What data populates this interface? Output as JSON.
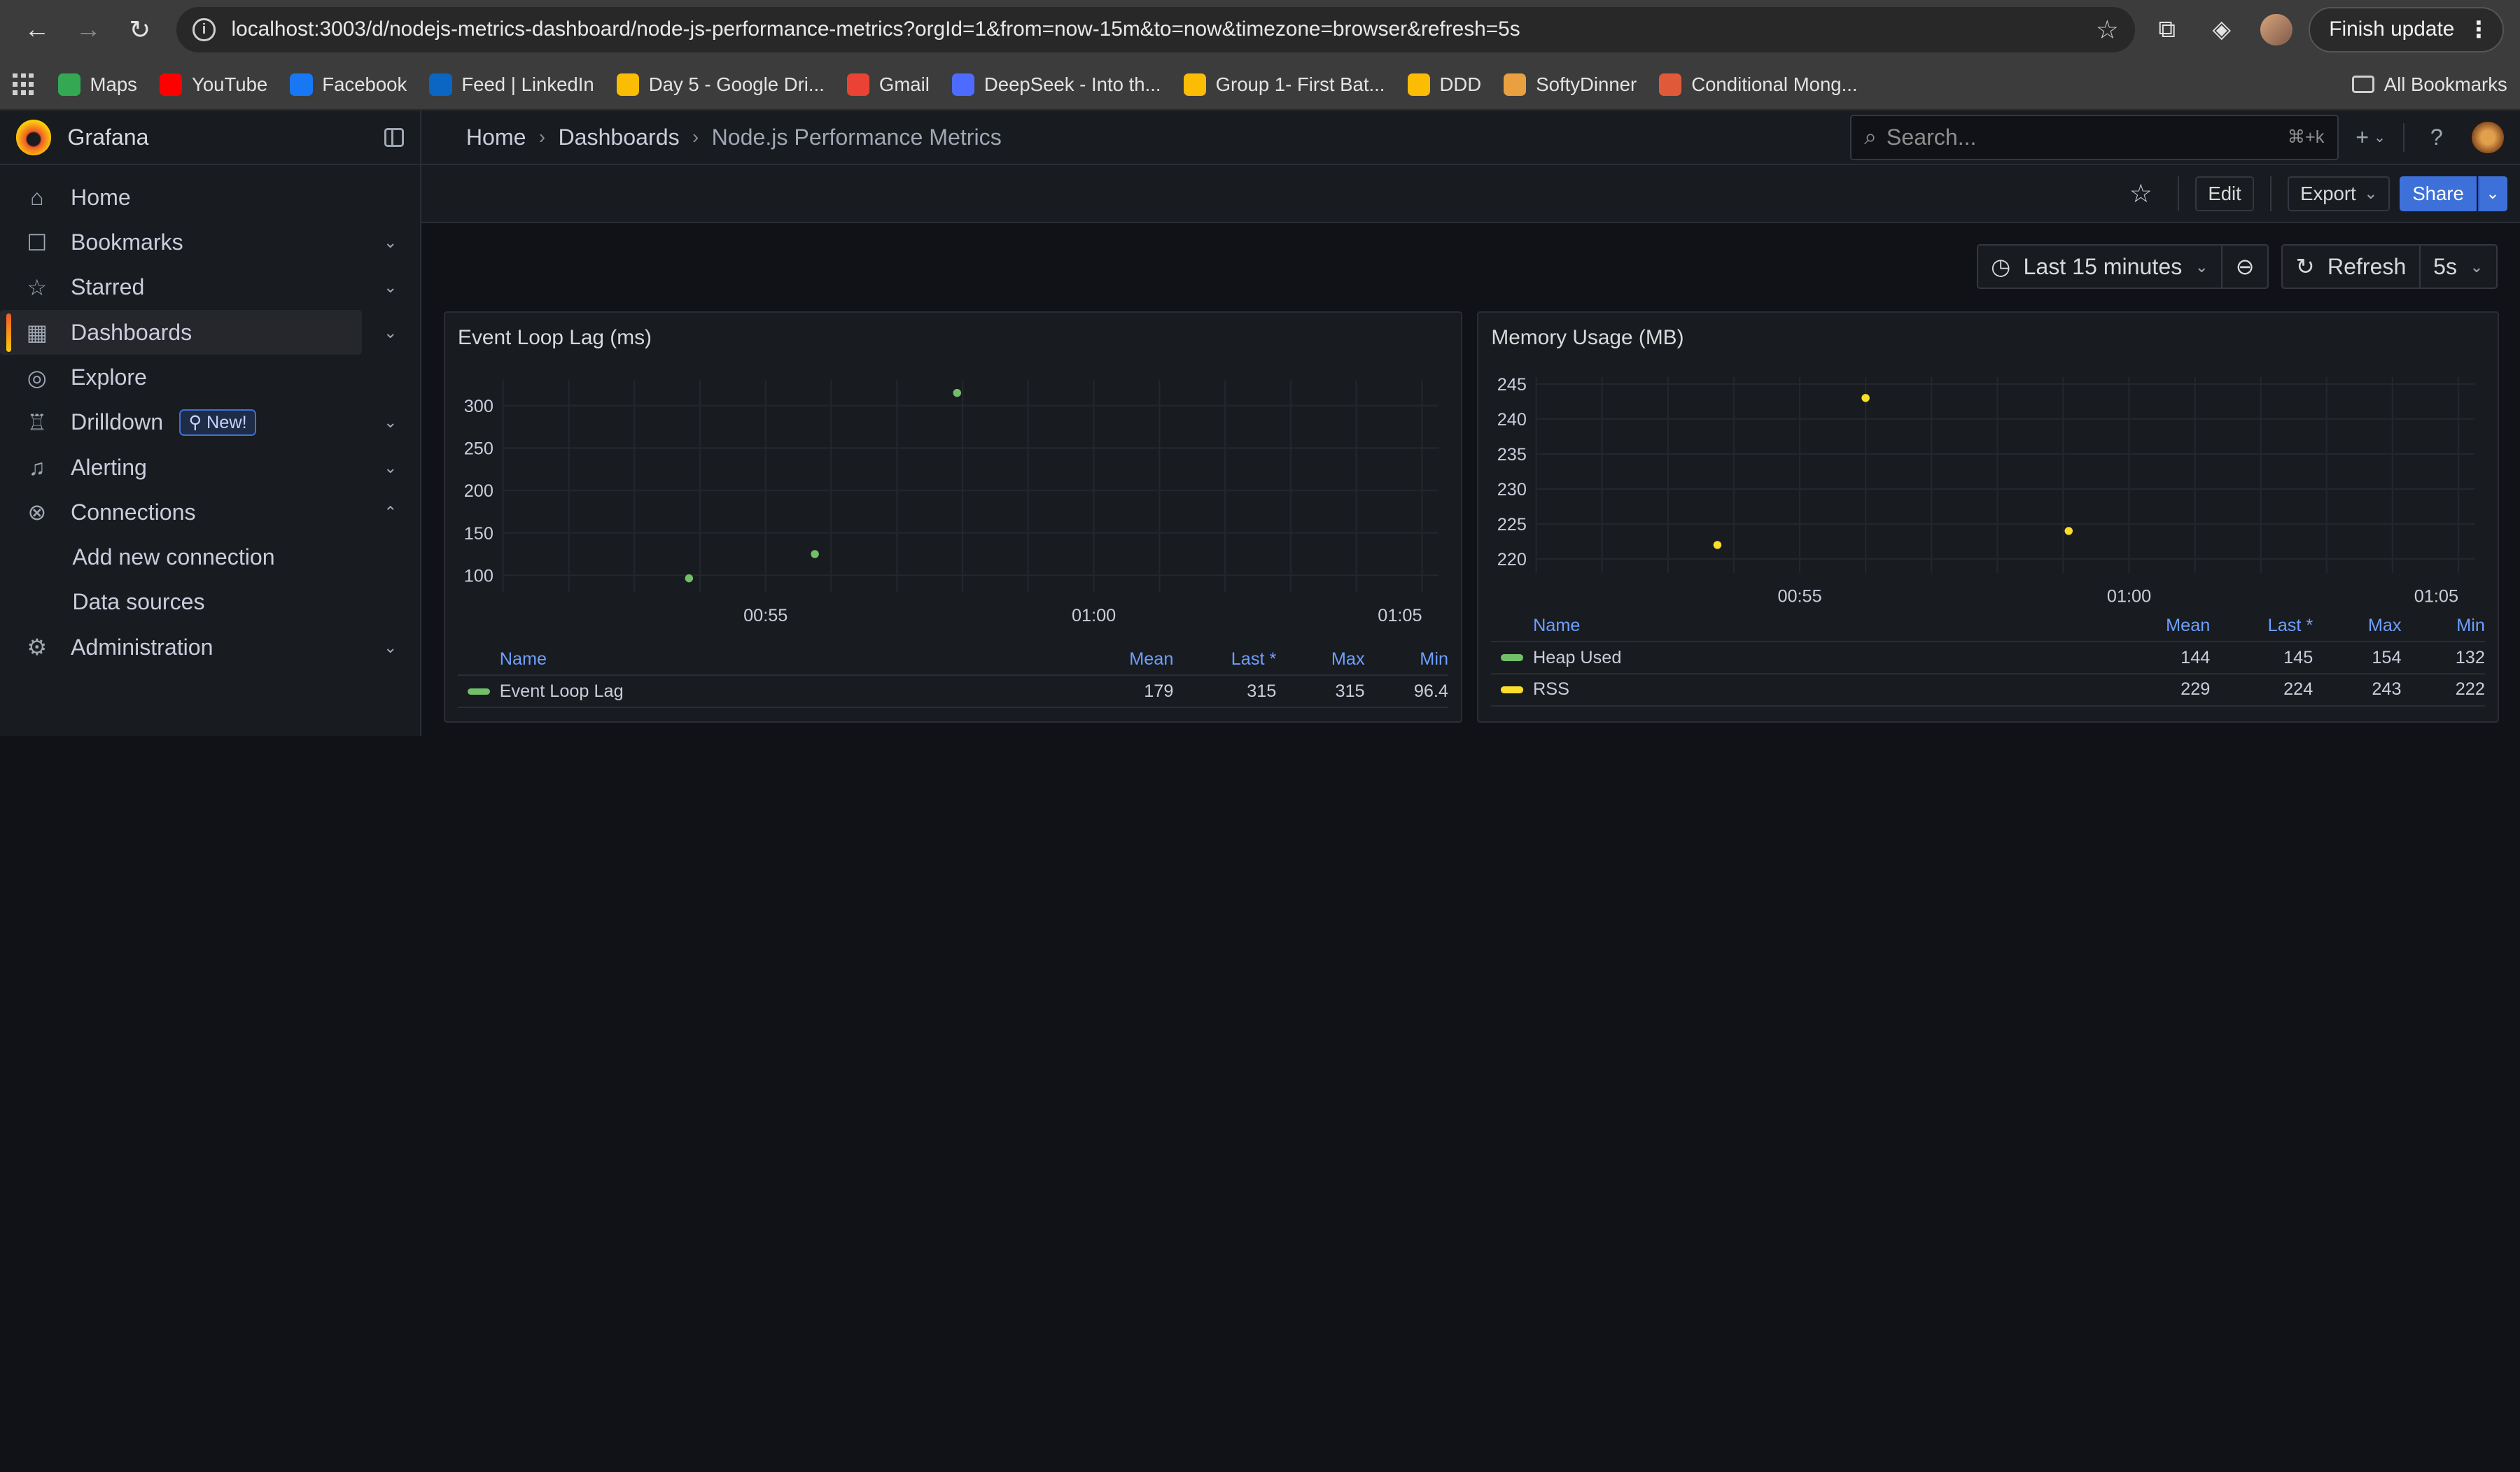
{
  "browser": {
    "url": "localhost:3003/d/nodejs-metrics-dashboard/node-js-performance-metrics?orgId=1&from=now-15m&to=now&timezone=browser&refresh=5s",
    "finish_update": "Finish update",
    "bookmarks": [
      {
        "label": "Maps",
        "color": "#34a853"
      },
      {
        "label": "YouTube",
        "color": "#ff0000"
      },
      {
        "label": "Facebook",
        "color": "#1877f2"
      },
      {
        "label": "Feed | LinkedIn",
        "color": "#0a66c2"
      },
      {
        "label": "Day 5 - Google Dri...",
        "color": "#fbbc04"
      },
      {
        "label": "Gmail",
        "color": "#ea4335"
      },
      {
        "label": "DeepSeek - Into th...",
        "color": "#4d6bfe"
      },
      {
        "label": "Group 1- First Bat...",
        "color": "#fbbc04"
      },
      {
        "label": "DDD",
        "color": "#fbbc04"
      },
      {
        "label": "SoftyDinner",
        "color": "#e8a040"
      },
      {
        "label": "Conditional Mong...",
        "color": "#e05a3a"
      }
    ],
    "all_bookmarks": "All Bookmarks"
  },
  "sidebar": {
    "title": "Grafana",
    "items": [
      {
        "label": "Home",
        "icon": "home-icon",
        "glyph": "⌂",
        "chevron": ""
      },
      {
        "label": "Bookmarks",
        "icon": "bookmark-icon",
        "glyph": "☐",
        "chevron": "⌄"
      },
      {
        "label": "Starred",
        "icon": "star-icon",
        "glyph": "☆",
        "chevron": "⌄"
      },
      {
        "label": "Dashboards",
        "icon": "dashboards-icon",
        "glyph": "▦",
        "chevron": "⌄"
      },
      {
        "label": "Explore",
        "icon": "compass-icon",
        "glyph": "◎",
        "chevron": ""
      },
      {
        "label": "Drilldown",
        "icon": "drilldown-icon",
        "glyph": "♖",
        "chevron": "⌄",
        "badge": "New!"
      },
      {
        "label": "Alerting",
        "icon": "bell-icon",
        "glyph": "♫",
        "chevron": "⌄"
      },
      {
        "label": "Connections",
        "icon": "connections-icon",
        "glyph": "⊗",
        "chevron": "⌃"
      }
    ],
    "sub_items": [
      "Add new connection",
      "Data sources"
    ],
    "admin": {
      "label": "Administration",
      "icon": "gear-icon",
      "glyph": "⚙",
      "chevron": "⌄"
    }
  },
  "topbar": {
    "breadcrumb": [
      "Home",
      "Dashboards",
      "Node.js Performance Metrics"
    ],
    "search_placeholder": "Search...",
    "search_shortcut": "⌘+k"
  },
  "toolbar": {
    "edit": "Edit",
    "export": "Export",
    "share": "Share"
  },
  "time_controls": {
    "range": "Last 15 minutes",
    "refresh": "Refresh",
    "interval": "5s"
  },
  "legend_headers": [
    "Name",
    "Mean",
    "Last *",
    "Max",
    "Min"
  ],
  "chart_data": [
    {
      "type": "scatter",
      "title": "Event Loop Lag (ms)",
      "x_ticks": [
        "00:55",
        "01:00",
        "01:05"
      ],
      "y_ticks": [
        100,
        150,
        200,
        250,
        300
      ],
      "ylim": [
        80,
        330
      ],
      "xlim": [
        "00:51:00",
        "01:05:15"
      ],
      "series": [
        {
          "name": "Event Loop Lag",
          "color": "#73bf69",
          "points": [
            {
              "x": "00:53:50",
              "y": 96.4
            },
            {
              "x": "00:55:45",
              "y": 125
            },
            {
              "x": "00:57:55",
              "y": 315
            }
          ],
          "mean": "179",
          "last": "315",
          "max": "315",
          "min": "96.4"
        }
      ]
    },
    {
      "type": "scatter",
      "title": "Memory Usage (MB)",
      "x_ticks": [
        "00:55",
        "01:00",
        "01:05"
      ],
      "y_ticks": [
        220,
        225,
        230,
        235,
        240,
        245
      ],
      "ylim": [
        218,
        246
      ],
      "xlim": [
        "00:51:00",
        "01:05:15"
      ],
      "series": [
        {
          "name": "Heap Used",
          "color": "#73bf69",
          "points": [],
          "mean": "144",
          "last": "145",
          "max": "154",
          "min": "132"
        },
        {
          "name": "RSS",
          "color": "#fade2a",
          "points": [
            {
              "x": "00:53:45",
              "y": 222
            },
            {
              "x": "00:56:00",
              "y": 243
            },
            {
              "x": "00:59:05",
              "y": 224
            }
          ],
          "mean": "229",
          "last": "224",
          "max": "243",
          "min": "222"
        }
      ]
    }
  ]
}
